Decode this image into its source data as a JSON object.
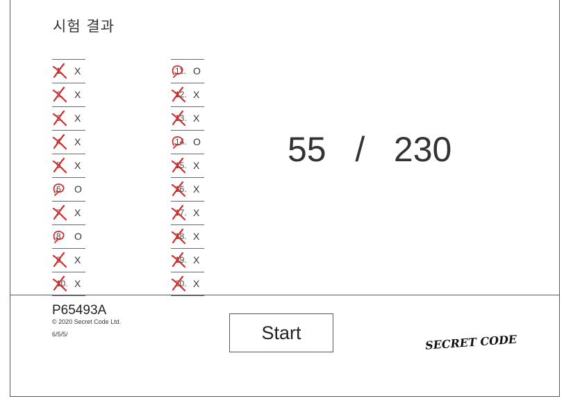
{
  "title": "시험 결과",
  "questions": [
    {
      "num": "1.",
      "answer": "X",
      "correct": false
    },
    {
      "num": "2.",
      "answer": "X",
      "correct": false
    },
    {
      "num": "3.",
      "answer": "X",
      "correct": false
    },
    {
      "num": "4.",
      "answer": "X",
      "correct": false
    },
    {
      "num": "5.",
      "answer": "X",
      "correct": false
    },
    {
      "num": "6.",
      "answer": "O",
      "correct": true
    },
    {
      "num": "7.",
      "answer": "X",
      "correct": false
    },
    {
      "num": "8.",
      "answer": "O",
      "correct": true
    },
    {
      "num": "9.",
      "answer": "X",
      "correct": false
    },
    {
      "num": "10.",
      "answer": "X",
      "correct": false
    },
    {
      "num": "11.",
      "answer": "O",
      "correct": true
    },
    {
      "num": "12.",
      "answer": "X",
      "correct": false
    },
    {
      "num": "13.",
      "answer": "X",
      "correct": false
    },
    {
      "num": "14.",
      "answer": "O",
      "correct": true
    },
    {
      "num": "15.",
      "answer": "X",
      "correct": false
    },
    {
      "num": "16.",
      "answer": "X",
      "correct": false
    },
    {
      "num": "17.",
      "answer": "X",
      "correct": false
    },
    {
      "num": "18.",
      "answer": "X",
      "correct": false
    },
    {
      "num": "19.",
      "answer": "X",
      "correct": false
    },
    {
      "num": "20.",
      "answer": "X",
      "correct": false
    }
  ],
  "score": {
    "earned": "55",
    "separator": "/",
    "total": "230"
  },
  "footer": {
    "code": "P65493A",
    "copyright": "© 2020 Secret Code Ltd.",
    "date": "6/5/5/",
    "start_label": "Start",
    "logo_text": "SECRET CODE"
  },
  "colors": {
    "mark": "#d42a2a",
    "line": "#666666"
  }
}
